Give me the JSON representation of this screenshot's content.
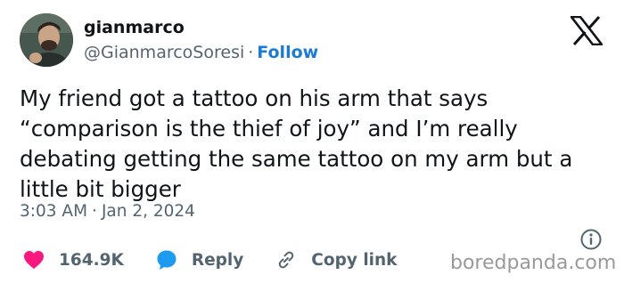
{
  "author": {
    "name": "gianmarco",
    "handle": "@GianmarcoSoresi",
    "separator": "·",
    "follow_label": "Follow"
  },
  "tweet": {
    "text": "My friend got a tattoo on his arm that says\n“comparison is the thief of joy” and I’m really\ndebating getting the same tattoo on my arm but a\nlittle bit bigger",
    "time": "3:03 AM",
    "date": "Jan 2, 2024",
    "separator": "·"
  },
  "actions": {
    "likes": "164.9K",
    "reply_label": "Reply",
    "copy_link_label": "Copy link"
  },
  "watermark": "boredpanda.com",
  "colors": {
    "like": "#f91880",
    "reply": "#1d9bf0",
    "follow": "#1d7bd8",
    "secondary_text": "#536471",
    "primary_text": "#0f1419"
  },
  "icons": [
    "x-logo-icon",
    "info-icon",
    "heart-icon",
    "reply-bubble-icon",
    "link-icon"
  ]
}
